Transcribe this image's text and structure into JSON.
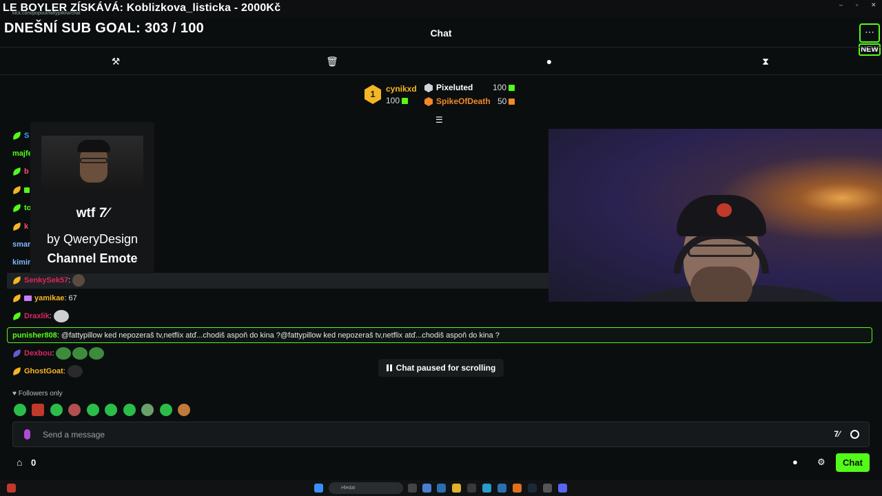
{
  "window": {
    "title": "LE BOYLER ZÍSKÁVÁ: Koblizkova_listicka - 2000Kč",
    "url": "kick.com/popout/fattypillow/chat"
  },
  "header": {
    "sub_goal": "DNEŠNÍ SUB GOAL: 303 / 100",
    "chat_title": "Chat",
    "menu_icon": "ellipsis-icon",
    "new_badge": "NEW"
  },
  "mod_tools": {
    "icons": [
      "gavel-icon",
      "trash-icon",
      "chat-bubble-icon",
      "hourglass-icon"
    ]
  },
  "leaderboard": {
    "first": {
      "rank": "1",
      "name": "cynikxd",
      "value": "100"
    },
    "second": {
      "name": "Pixeluted",
      "value": "100"
    },
    "third": {
      "name": "SpikeOfDeath",
      "value": "50"
    }
  },
  "emote_card": {
    "emote_name": "wtf",
    "author": "by QweryDesign",
    "type": "Channel Emote",
    "provider_icon": "7tv-icon"
  },
  "messages": [
    {
      "user": "S",
      "color": "#3aa0ff",
      "text": ""
    },
    {
      "user": "majfe",
      "color": "#53fc18",
      "text": ""
    },
    {
      "user": "b",
      "color": "#ff4d6d",
      "text": ""
    },
    {
      "user": "",
      "color": "#53fc18",
      "text": ""
    },
    {
      "user": "to",
      "color": "#53fc18",
      "text": ""
    },
    {
      "user": "k",
      "color": "#ff4d6d",
      "text": ""
    },
    {
      "user": "smar",
      "color": "#7fb6ff",
      "text": ""
    },
    {
      "user": "kimir",
      "color": "#7fb6ff",
      "text": ""
    },
    {
      "user": "SenkySek57",
      "color": "#e0245e",
      "text": ""
    },
    {
      "user": "yamikae",
      "color": "#f5b623",
      "text": " 67"
    },
    {
      "user": "Draxlik",
      "color": "#e0245e",
      "text": ""
    },
    {
      "user": "punisher808",
      "color": "#53fc18",
      "text": " @fattypillow ked nepozeraš tv,netflix atď...chodiš aspoň do kina ?@fattypillow ked nepozeraš tv,netflix atď...chodiš aspoň do kina ?"
    },
    {
      "user": "Dexbou",
      "color": "#e0245e",
      "text": ""
    },
    {
      "user": "GhostGoat",
      "color": "#f5b623",
      "text": ""
    }
  ],
  "paused_label": "Chat paused for scrolling",
  "followers_label": "Followers only",
  "input": {
    "placeholder": "Send a message"
  },
  "footer": {
    "store_count": "0",
    "chat_button": "Chat"
  },
  "taskbar": {
    "search_placeholder": "Hledat"
  },
  "colors": {
    "accent": "#53fc18",
    "background": "#0b0e0f"
  }
}
